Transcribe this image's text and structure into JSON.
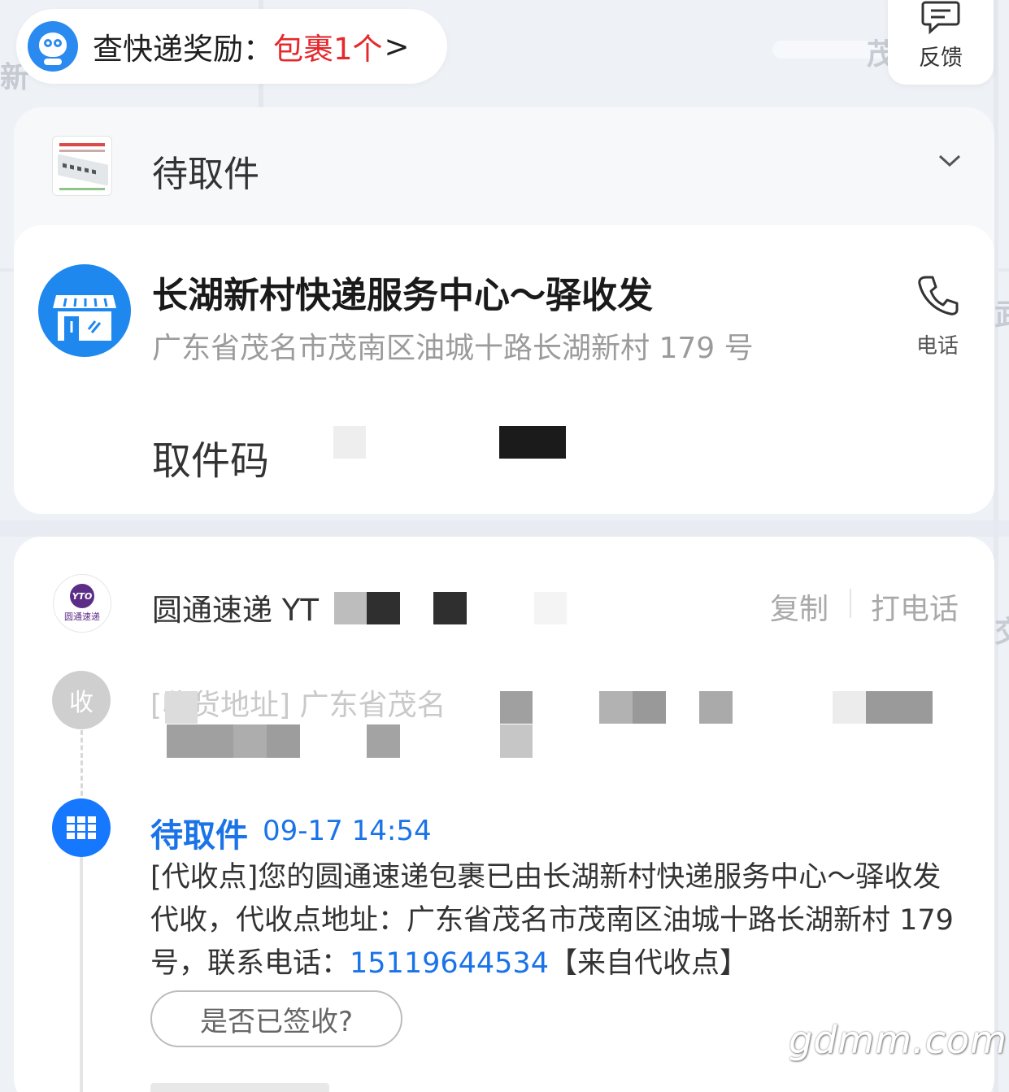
{
  "map": {
    "labels": [
      "新",
      "茂芋路",
      "武",
      "交"
    ]
  },
  "reward": {
    "label": "查快递奖励：",
    "highlight": "包裹1个",
    "arrow": ">"
  },
  "feedback": {
    "label": "反馈",
    "icon": "feedback-icon"
  },
  "pending": {
    "title": "待取件"
  },
  "station": {
    "name": "长湖新村快递服务中心～驿收发",
    "address": "广东省茂名市茂南区油城十路长湖新村 179 号",
    "phone_label": "电话",
    "code_label": "取件码"
  },
  "carrier": {
    "logo_text": "YTO",
    "logo_caption": "圆通速递",
    "name": "圆通速递 YT",
    "copy_label": "复制",
    "call_label": "打电话"
  },
  "timeline": {
    "recv_node": "收",
    "recv_address": "[收货地址] 广东省茂名",
    "event": {
      "status": "待取件",
      "time": "09-17 14:54",
      "desc_before": "[代收点]您的圆通速递包裹已由长湖新村快递服务中心～驿收发代收，代收点地址：广东省茂名市茂南区油城十路长湖新村 179 号，联系电话：",
      "phone": "15119644534",
      "desc_after": "【来自代收点】",
      "sign_button": "是否已签收?"
    }
  },
  "watermark": "gdmm.com",
  "colors": {
    "accent": "#1a73e8",
    "reward_red": "#e6282d",
    "carrier_purple": "#5b2d86"
  }
}
